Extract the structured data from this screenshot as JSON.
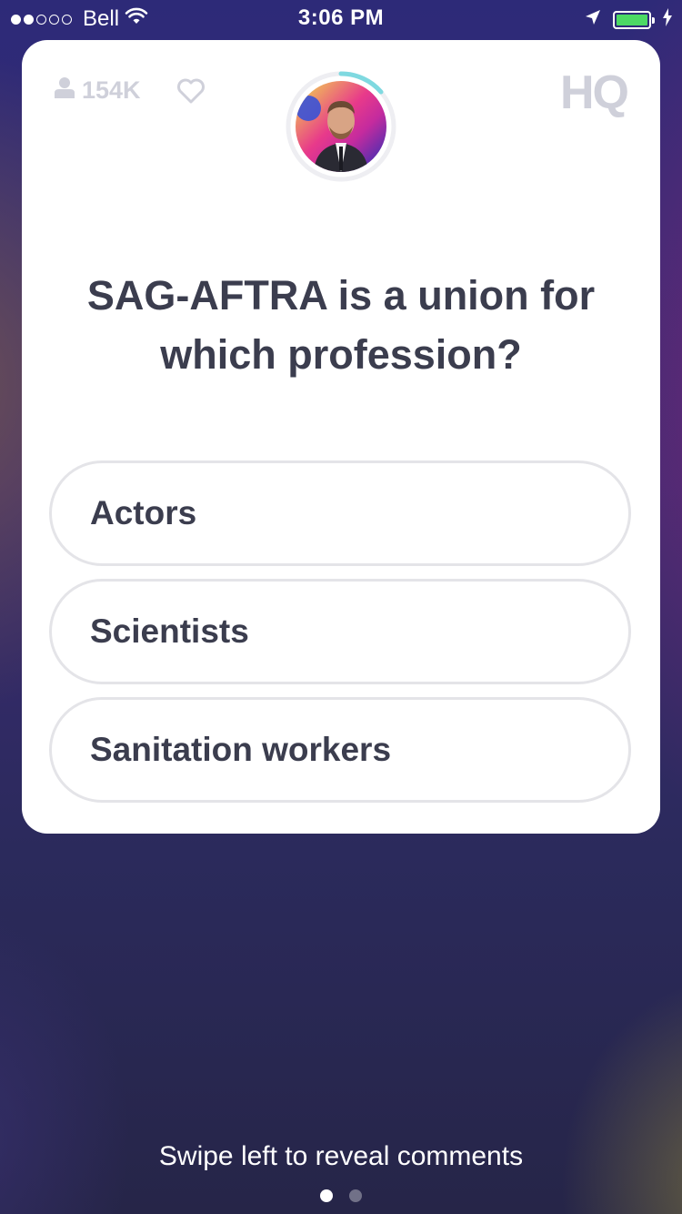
{
  "status_bar": {
    "carrier": "Bell",
    "time": "3:06 PM"
  },
  "header": {
    "viewer_count": "154K",
    "logo_text": "HQ"
  },
  "question": {
    "text": "SAG-AFTRA is a union for which profession?"
  },
  "answers": [
    {
      "label": "Actors"
    },
    {
      "label": "Scientists"
    },
    {
      "label": "Sanitation workers"
    }
  ],
  "footer": {
    "swipe_hint": "Swipe left to reveal comments"
  },
  "colors": {
    "card_background": "#ffffff",
    "text_primary": "#3b3d4e",
    "muted": "#cfd0da",
    "timer_accent": "#7fd9e0",
    "battery": "#4cd964"
  },
  "icons": [
    "wifi-icon",
    "location-arrow-icon",
    "battery-icon",
    "charging-bolt-icon",
    "user-icon",
    "heart-icon"
  ]
}
